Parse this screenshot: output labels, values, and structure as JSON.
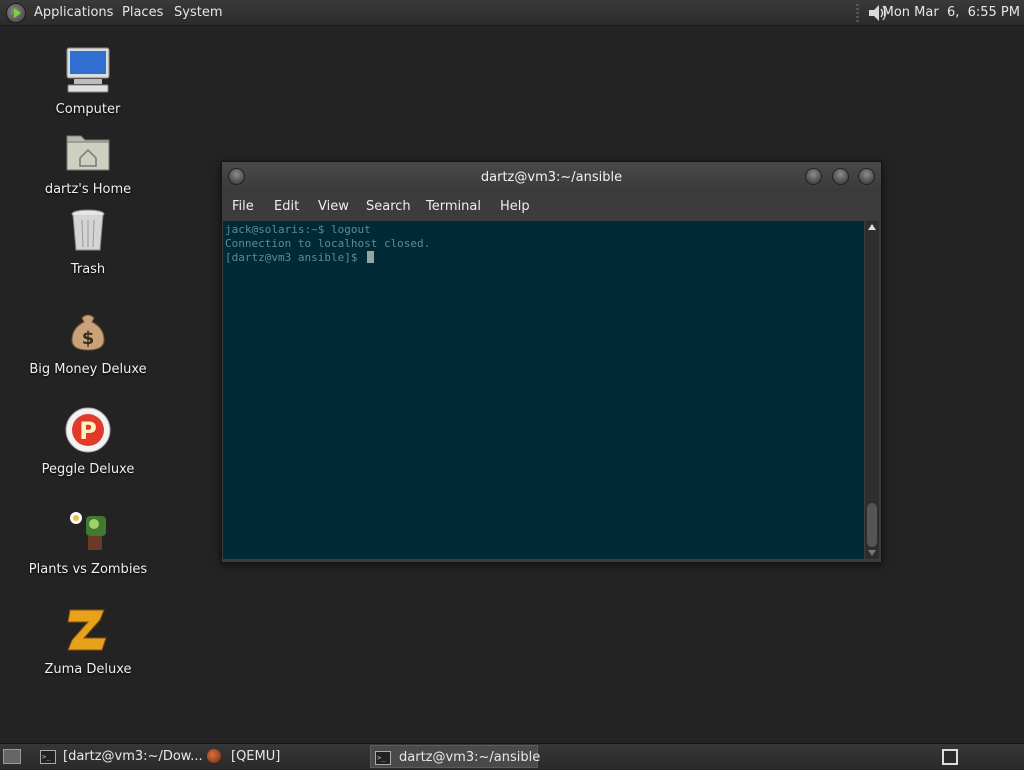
{
  "top_panel": {
    "menus": [
      "Applications",
      "Places",
      "System"
    ],
    "clock": "Mon Mar  6,  6:55 PM"
  },
  "desktop_icons": [
    {
      "label": "Computer",
      "icon": "computer-icon"
    },
    {
      "label": "dartz's Home",
      "icon": "home-folder-icon"
    },
    {
      "label": "Trash",
      "icon": "trash-icon"
    },
    {
      "label": "Big Money Deluxe",
      "icon": "money-bag-icon"
    },
    {
      "label": "Peggle Deluxe",
      "icon": "peggle-icon"
    },
    {
      "label": "Plants vs Zombies",
      "icon": "plants-zombies-icon"
    },
    {
      "label": "Zuma Deluxe",
      "icon": "zuma-icon"
    }
  ],
  "terminal_window": {
    "title": "dartz@vm3:~/ansible",
    "menu": [
      "File",
      "Edit",
      "View",
      "Search",
      "Terminal",
      "Help"
    ],
    "lines": [
      "jack@solaris:~$ logout",
      "Connection to localhost closed.",
      "[dartz@vm3 ansible]$ "
    ]
  },
  "taskbar": {
    "tasks": [
      {
        "label": "[dartz@vm3:~/Dow..."
      },
      {
        "label": "[QEMU]"
      },
      {
        "label": "dartz@vm3:~/ansible"
      }
    ]
  },
  "colors": {
    "terminal_bg": "#002b36",
    "terminal_fg": "#5f8a93",
    "panel_bg": "#2b2b2b",
    "desktop_bg": "#232323"
  }
}
